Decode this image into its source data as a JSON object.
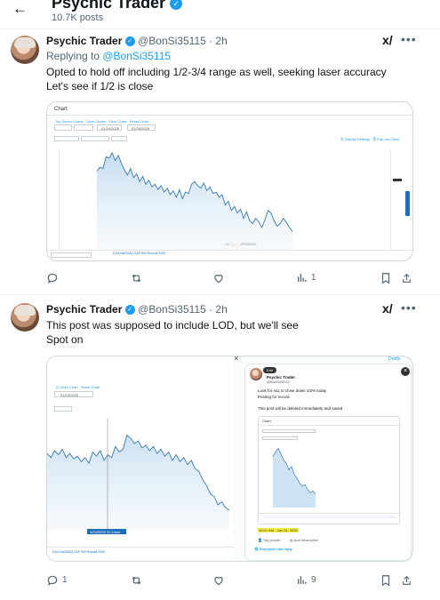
{
  "header": {
    "title": "Psychic Trader",
    "views": "10.7K posts"
  },
  "tweet1": {
    "name": "Psychic Trader",
    "handle": "@BonSi35115 · 2h",
    "replying_prefix": "Replying to ",
    "replying_to": "@BonSi35115",
    "text_line1": "Opted to hold off including 1/2-3/4 range as well, seeking laser accuracy",
    "text_line2": "Let's see if 1/2 is close",
    "media": {
      "card_title": "Chart",
      "date_from": "01/24/2025",
      "date_to": "01/24/2025",
      "watermark": "Activate Windows",
      "watermark_sub": "Go to Settings to activate Windows.",
      "ticker": "DJIA  NASDAQ  S&P 500  Russell 2000"
    },
    "actions": {
      "reply": "",
      "repost": "",
      "like": "",
      "views": "1"
    }
  },
  "tweet2": {
    "name": "Psychic Trader",
    "handle": "@BonSi35115 · 2h",
    "text_line1": "This post was supposed to include LOD, but we'll see",
    "text_line2": "Spot on",
    "media": {
      "left_date": "01/24/2025",
      "crosshair_label": "1/24/2025 11:13am",
      "inner_name": "Psychic Trader",
      "inner_handle": "@BonSi35115",
      "inner_line1": "Look for naz to close down 1/2% today",
      "inner_line2": "Posting for record",
      "inner_line3": "This post will be deleted immediately and saved",
      "inner_chart_title": "Chart",
      "inner_time": "10:01 AM · Jan 24, 2025",
      "tag_people": "Tag people",
      "add_description": "Add description",
      "everyone_reply": "Everyone can reply",
      "edit_label": "Edit",
      "drafts_label": "Drafts"
    },
    "actions": {
      "reply": "1",
      "repost": "",
      "like": "",
      "views": "9"
    }
  },
  "chart_data": [
    {
      "type": "line",
      "title": "",
      "series": [
        {
          "values": [
            60,
            63,
            62,
            71,
            70,
            74,
            68,
            72,
            66,
            61,
            57,
            62,
            55,
            58,
            52,
            56,
            50,
            53,
            48,
            50,
            46,
            49,
            44,
            47,
            42,
            45,
            40,
            46,
            39,
            44,
            43,
            50,
            52,
            49,
            47,
            51,
            45,
            48,
            43,
            44,
            40,
            42,
            34,
            37,
            30,
            33,
            28,
            31,
            24,
            29,
            22,
            20,
            24,
            21,
            17,
            23,
            30,
            28,
            22,
            18,
            20,
            24,
            21,
            17,
            14
          ]
        }
      ]
    },
    {
      "type": "line",
      "title": "",
      "series": [
        {
          "values": [
            55,
            52,
            57,
            54,
            58,
            52,
            55,
            51,
            53,
            49,
            52,
            48,
            56,
            53,
            57,
            50,
            54,
            52,
            60,
            56,
            58,
            68,
            66,
            62,
            64,
            59,
            61,
            57,
            60,
            55,
            58,
            53,
            56,
            50,
            54,
            49,
            52,
            47,
            50,
            44,
            42,
            36,
            32,
            26,
            24,
            18,
            20,
            16,
            14
          ]
        }
      ]
    },
    {
      "type": "line",
      "title": "",
      "series": [
        {
          "values": [
            62,
            68,
            72,
            65,
            58,
            54,
            46,
            50,
            40,
            36,
            30,
            26,
            28,
            22,
            18,
            20,
            16
          ]
        }
      ]
    }
  ]
}
